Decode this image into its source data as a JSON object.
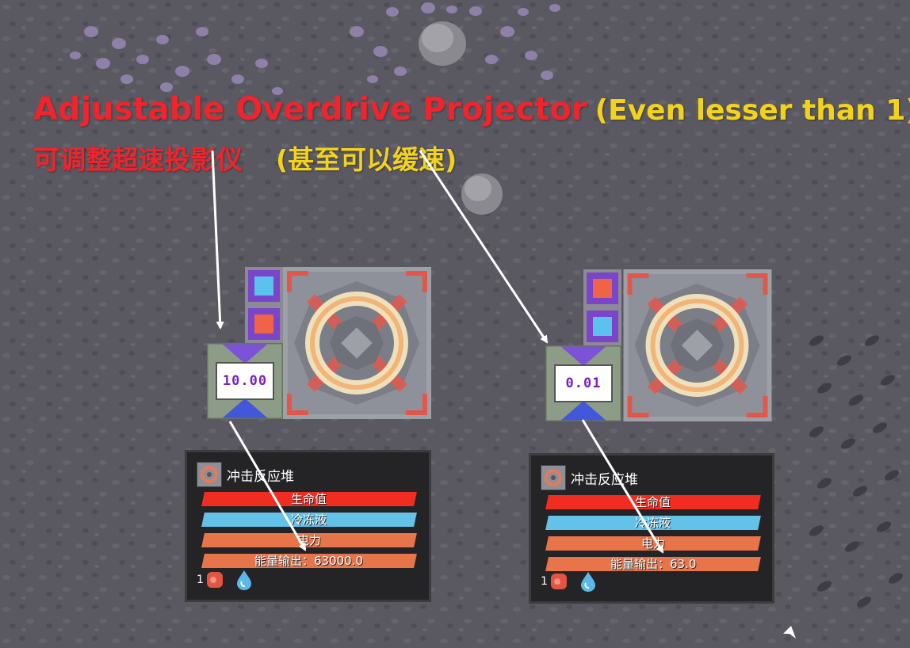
{
  "title": {
    "en_main": "Adjustable Overdrive Projector",
    "en_note": "(Even lesser than 1)",
    "cn_main": "可调整超速投影仪",
    "cn_note": "(甚至可以缓速)"
  },
  "colors": {
    "title_main": "#f0242c",
    "title_note": "#f3d21d",
    "health": "#f02d20",
    "cryofluid": "#64c1e8",
    "power": "#e8744a",
    "projector_text": "#7a1ec0"
  },
  "setups": [
    {
      "projector_value": "10.00",
      "panel": {
        "block_name": "冲击反应堆",
        "health_label": "生命值",
        "cryofluid_label": "冷冻液",
        "power_label": "电力",
        "output_label": "能量输出：63000.0",
        "item_count": "1",
        "icons": [
          "impact-reactor-icon",
          "blast-compound-icon",
          "cryofluid-icon"
        ]
      }
    },
    {
      "projector_value": "0.01",
      "panel": {
        "block_name": "冲击反应堆",
        "health_label": "生命值",
        "cryofluid_label": "冷冻液",
        "power_label": "电力",
        "output_label": "能量输出：63.0",
        "item_count": "1",
        "icons": [
          "impact-reactor-icon",
          "blast-compound-icon",
          "cryofluid-icon"
        ]
      }
    }
  ]
}
